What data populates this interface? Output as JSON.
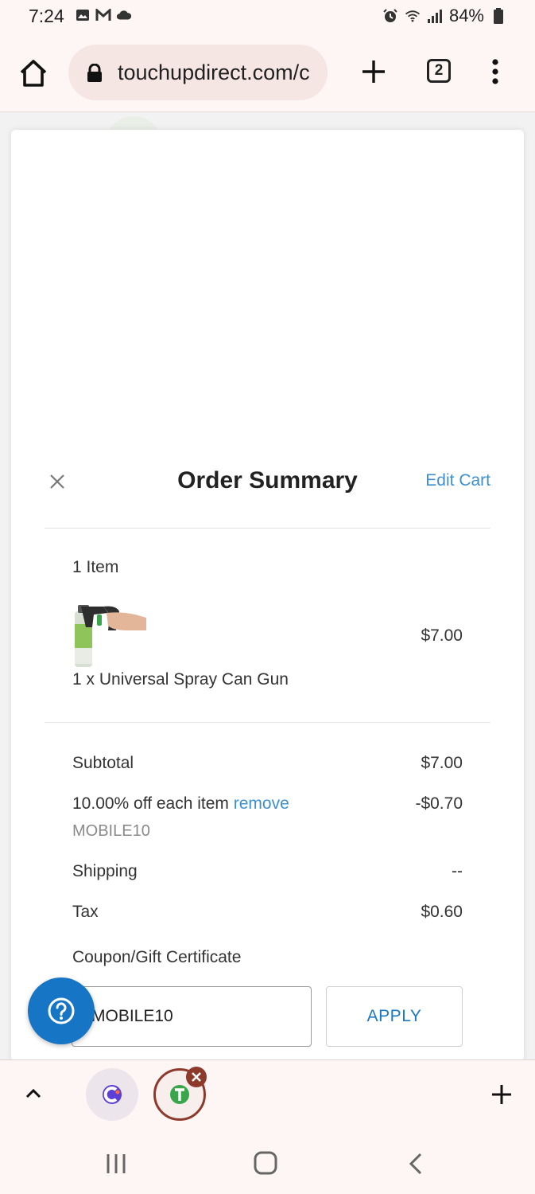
{
  "status_bar": {
    "time": "7:24",
    "battery": "84%"
  },
  "browser": {
    "url": "touchupdirect.com/c",
    "tab_count": "2"
  },
  "order_summary": {
    "title": "Order Summary",
    "edit_cart_label": "Edit Cart",
    "item_count_label": "1 Item",
    "item": {
      "name": "1 x Universal Spray Can Gun",
      "price": "$7.00"
    },
    "subtotal_label": "Subtotal",
    "subtotal_value": "$7.00",
    "discount_label": "10.00% off each item",
    "discount_remove_label": "remove",
    "discount_value": "-$0.70",
    "discount_code": "MOBILE10",
    "shipping_label": "Shipping",
    "shipping_value": "--",
    "tax_label": "Tax",
    "tax_value": "$0.60",
    "coupon_label": "Coupon/Gift Certificate",
    "coupon_input_value": "MOBILE10",
    "apply_label": "APPLY"
  },
  "colors": {
    "link": "#3f8fcf",
    "help_button": "#1675c5",
    "apply_text": "#1a79c4"
  },
  "icons": {
    "help": "question-circle-icon",
    "close": "close-icon"
  }
}
